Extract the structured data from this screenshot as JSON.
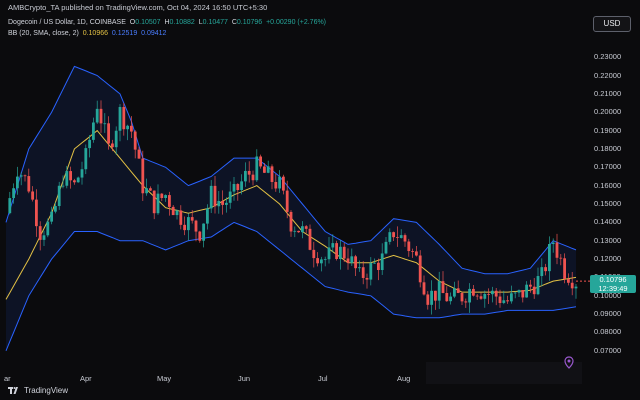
{
  "header": {
    "attribution": "AMBCrypto_TA published on TradingView.com, Oct 04, 2024 16:50 UTC+5:30",
    "currency": "USD"
  },
  "legend": {
    "symbol": "Dogecoin / US Dollar, 1D, COINBASE",
    "o_label": "O",
    "o_value": "0.10507",
    "h_label": "H",
    "h_value": "0.10882",
    "l_label": "L",
    "l_value": "0.10477",
    "c_label": "C",
    "c_value": "0.10796",
    "change": "+0.00290 (+2.76%)",
    "bb_label": "BB (20, SMA, close, 2)",
    "bb_basis": "0.10966",
    "bb_upper": "0.12519",
    "bb_lower": "0.09412"
  },
  "price_axis": [
    "0.23000",
    "0.22000",
    "0.21000",
    "0.20000",
    "0.19000",
    "0.18000",
    "0.17000",
    "0.16000",
    "0.15000",
    "0.14000",
    "0.13000",
    "0.12000",
    "0.11000",
    "0.10000",
    "0.09000",
    "0.08000",
    "0.07000"
  ],
  "time_axis": [
    "ar",
    "Apr",
    "May",
    "Jun",
    "Jul",
    "Aug"
  ],
  "last_price": {
    "value": "0.10796",
    "countdown": "12:39:49"
  },
  "footer": {
    "brand": "TradingView"
  },
  "colors": {
    "up": "#26a69a",
    "down": "#ef5350",
    "basis": "#e2c044",
    "band": "#2962ff",
    "background": "#0b0b0d"
  },
  "chart_data": {
    "type": "candlestick",
    "ylim": [
      0.065,
      0.235
    ],
    "y_ticks": [
      0.23,
      0.22,
      0.21,
      0.2,
      0.19,
      0.18,
      0.17,
      0.16,
      0.15,
      0.14,
      0.13,
      0.12,
      0.11,
      0.1,
      0.09,
      0.08,
      0.07
    ],
    "indicator": "BB (20, SMA, close, 2)",
    "close_path": [
      [
        0,
        0.145
      ],
      [
        3,
        0.17
      ],
      [
        6,
        0.16
      ],
      [
        9,
        0.135
      ],
      [
        12,
        0.14
      ],
      [
        15,
        0.165
      ],
      [
        18,
        0.16
      ],
      [
        21,
        0.175
      ],
      [
        24,
        0.205
      ],
      [
        27,
        0.18
      ],
      [
        30,
        0.2
      ],
      [
        33,
        0.19
      ],
      [
        36,
        0.16
      ],
      [
        39,
        0.15
      ],
      [
        42,
        0.155
      ],
      [
        45,
        0.145
      ],
      [
        48,
        0.14
      ],
      [
        51,
        0.135
      ],
      [
        54,
        0.155
      ],
      [
        57,
        0.15
      ],
      [
        60,
        0.155
      ],
      [
        63,
        0.165
      ],
      [
        66,
        0.17
      ],
      [
        69,
        0.165
      ],
      [
        72,
        0.16
      ],
      [
        75,
        0.14
      ],
      [
        78,
        0.135
      ],
      [
        81,
        0.125
      ],
      [
        84,
        0.12
      ],
      [
        87,
        0.125
      ],
      [
        90,
        0.122
      ],
      [
        93,
        0.11
      ],
      [
        96,
        0.115
      ],
      [
        99,
        0.12
      ],
      [
        102,
        0.135
      ],
      [
        105,
        0.13
      ],
      [
        108,
        0.12
      ],
      [
        111,
        0.1
      ],
      [
        114,
        0.102
      ],
      [
        117,
        0.098
      ],
      [
        120,
        0.1
      ],
      [
        123,
        0.105
      ],
      [
        126,
        0.102
      ],
      [
        129,
        0.1
      ],
      [
        132,
        0.097
      ],
      [
        135,
        0.1
      ],
      [
        138,
        0.105
      ],
      [
        141,
        0.11
      ],
      [
        144,
        0.13
      ],
      [
        147,
        0.114
      ],
      [
        150,
        0.108
      ]
    ],
    "upper_band": [
      [
        0,
        0.14
      ],
      [
        6,
        0.18
      ],
      [
        12,
        0.2
      ],
      [
        18,
        0.225
      ],
      [
        24,
        0.22
      ],
      [
        30,
        0.21
      ],
      [
        33,
        0.195
      ],
      [
        36,
        0.175
      ],
      [
        42,
        0.17
      ],
      [
        48,
        0.16
      ],
      [
        54,
        0.165
      ],
      [
        60,
        0.175
      ],
      [
        66,
        0.175
      ],
      [
        72,
        0.165
      ],
      [
        78,
        0.15
      ],
      [
        84,
        0.135
      ],
      [
        90,
        0.128
      ],
      [
        96,
        0.13
      ],
      [
        102,
        0.142
      ],
      [
        108,
        0.14
      ],
      [
        114,
        0.128
      ],
      [
        120,
        0.115
      ],
      [
        126,
        0.112
      ],
      [
        132,
        0.112
      ],
      [
        138,
        0.115
      ],
      [
        144,
        0.13
      ],
      [
        150,
        0.125
      ]
    ],
    "basis": [
      [
        0,
        0.098
      ],
      [
        6,
        0.12
      ],
      [
        12,
        0.145
      ],
      [
        18,
        0.18
      ],
      [
        24,
        0.19
      ],
      [
        30,
        0.175
      ],
      [
        36,
        0.16
      ],
      [
        42,
        0.148
      ],
      [
        48,
        0.145
      ],
      [
        54,
        0.148
      ],
      [
        60,
        0.155
      ],
      [
        66,
        0.16
      ],
      [
        72,
        0.15
      ],
      [
        78,
        0.135
      ],
      [
        84,
        0.127
      ],
      [
        90,
        0.118
      ],
      [
        96,
        0.118
      ],
      [
        102,
        0.122
      ],
      [
        108,
        0.118
      ],
      [
        114,
        0.108
      ],
      [
        120,
        0.102
      ],
      [
        126,
        0.102
      ],
      [
        132,
        0.102
      ],
      [
        138,
        0.103
      ],
      [
        144,
        0.108
      ],
      [
        150,
        0.11
      ]
    ],
    "lower_band": [
      [
        0,
        0.07
      ],
      [
        6,
        0.1
      ],
      [
        12,
        0.12
      ],
      [
        18,
        0.135
      ],
      [
        24,
        0.135
      ],
      [
        30,
        0.13
      ],
      [
        36,
        0.13
      ],
      [
        42,
        0.125
      ],
      [
        48,
        0.13
      ],
      [
        54,
        0.132
      ],
      [
        60,
        0.14
      ],
      [
        66,
        0.135
      ],
      [
        72,
        0.125
      ],
      [
        78,
        0.115
      ],
      [
        84,
        0.105
      ],
      [
        90,
        0.102
      ],
      [
        96,
        0.1
      ],
      [
        102,
        0.09
      ],
      [
        108,
        0.088
      ],
      [
        114,
        0.088
      ],
      [
        120,
        0.09
      ],
      [
        126,
        0.09
      ],
      [
        132,
        0.092
      ],
      [
        138,
        0.092
      ],
      [
        144,
        0.092
      ],
      [
        150,
        0.094
      ]
    ],
    "last_close": 0.10796
  }
}
